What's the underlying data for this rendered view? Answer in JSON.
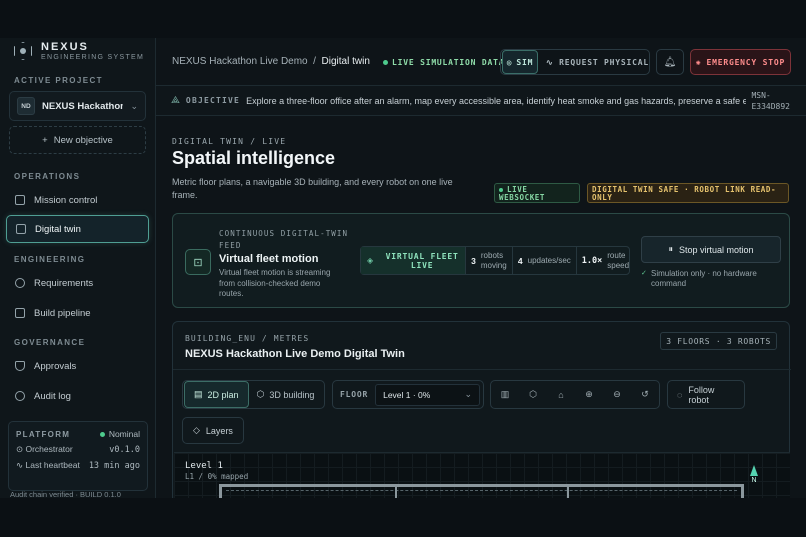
{
  "brand": {
    "name": "NEXUS",
    "subtitle": "ENGINEERING SYSTEM"
  },
  "sidebar": {
    "active_project_label": "ACTIVE PROJECT",
    "project": {
      "badge": "ND",
      "name": "NEXUS Hackathon ..."
    },
    "new_objective": "New objective",
    "sections": {
      "operations": "OPERATIONS",
      "engineering": "ENGINEERING",
      "governance": "GOVERNANCE"
    },
    "items": [
      {
        "label": "Mission control",
        "icon": "grid-icon"
      },
      {
        "label": "Digital twin",
        "icon": "map-icon"
      },
      {
        "label": "Requirements",
        "icon": "git-branch-icon"
      },
      {
        "label": "Build pipeline",
        "icon": "pipeline-icon"
      },
      {
        "label": "Approvals",
        "icon": "shield-icon"
      },
      {
        "label": "Audit log",
        "icon": "clock-icon"
      }
    ],
    "platform": {
      "label": "PLATFORM",
      "status": "Nominal",
      "orchestrator_label": "Orchestrator",
      "orchestrator_value": "v0.1.0",
      "heartbeat_label": "Last heartbeat",
      "heartbeat_value": "13 min ago"
    },
    "audit_footer": "Audit chain verified · BUILD 0.1.0"
  },
  "topbar": {
    "breadcrumb_parent": "NEXUS Hackathon Live Demo",
    "breadcrumb_current": "Digital twin",
    "live_label": "LIVE SIMULATION DATA",
    "sim_label": "SIM",
    "request_label": "REQUEST PHYSICAL",
    "estop_label": "EMERGENCY STOP"
  },
  "objective": {
    "label": "OBJECTIVE",
    "text": "Explore a three-floor office after an alarm, map every accessible area, identify heat smoke and gas hazards, preserve a safe egress r",
    "mission_id_1": "MSN-",
    "mission_id_2": "E334D892"
  },
  "header": {
    "eyebrow": "DIGITAL TWIN / LIVE",
    "title": "Spatial intelligence",
    "subtitle": "Metric floor plans, a navigable 3D building, and every robot on one live frame.",
    "ws_pill": "LIVE WEBSOCKET",
    "safe_pill": "DIGITAL TWIN SAFE · ROBOT LINK READ-ONLY"
  },
  "fleet_card": {
    "eyebrow": "CONTINUOUS DIGITAL-TWIN FEED",
    "title": "Virtual fleet motion",
    "description": "Virtual fleet motion is streaming from collision-checked demo routes.",
    "live_label": "VIRTUAL FLEET LIVE",
    "robots_num": "3",
    "robots_label": "robots moving",
    "updates_num": "4",
    "updates_label": "updates/sec",
    "speed_num": "1.0×",
    "speed_label": "route speed",
    "stop_button": "Stop virtual motion",
    "note": "Simulation only · no hardware command"
  },
  "twin_card": {
    "eyebrow": "BUILDING_ENU / METRES",
    "title": "NEXUS Hackathon Live Demo Digital Twin",
    "floors_badge": "3 FLOORS · 3 ROBOTS",
    "view_2d": "2D plan",
    "view_3d": "3D building",
    "floor_label": "FLOOR",
    "floor_value": "Level 1 · 0%",
    "follow_robot": "Follow robot",
    "layers": "Layers",
    "level_title": "Level 1",
    "level_sub": "L1 / 0% mapped",
    "north": "N"
  },
  "colors": {
    "accent": "#4f9e93",
    "live_green": "#8fdca9",
    "warning": "#e6c36e",
    "danger": "#ff8d8d"
  }
}
